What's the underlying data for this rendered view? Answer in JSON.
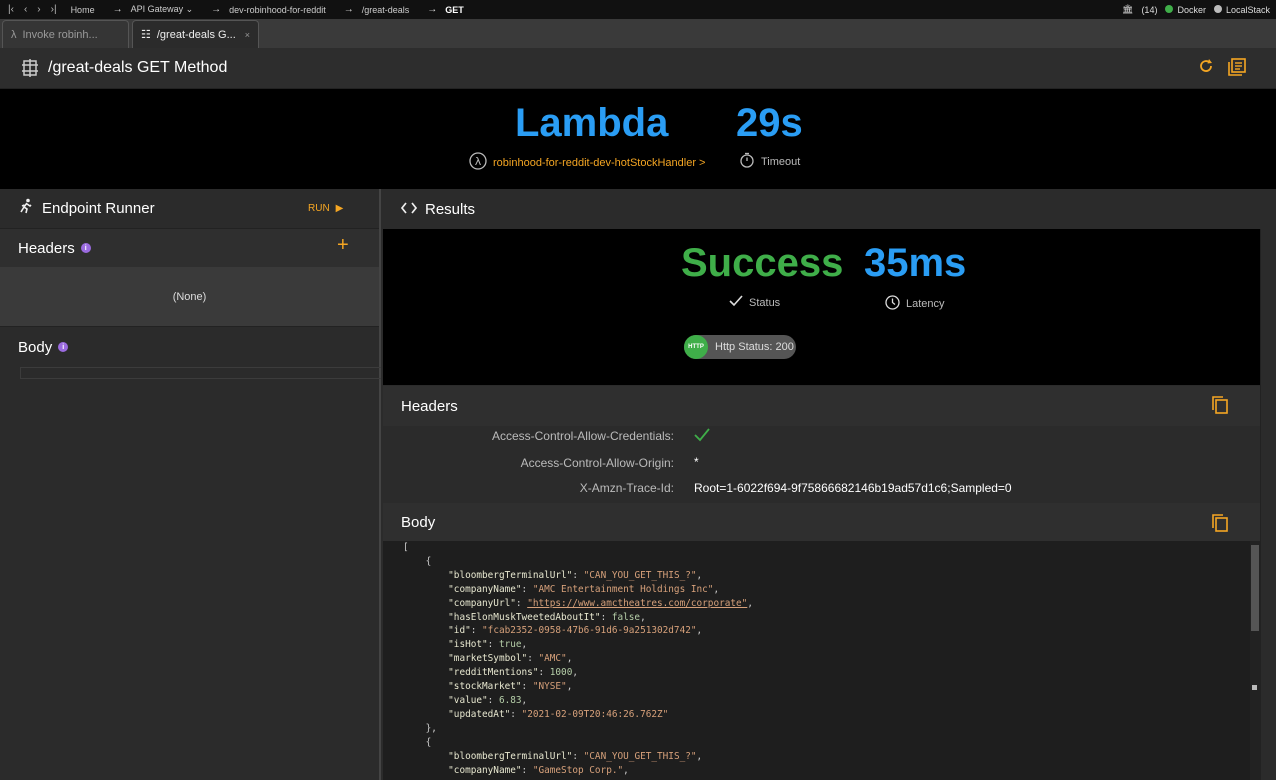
{
  "topbar": {
    "breadcrumb": [
      "Home",
      "API Gateway",
      "dev-robinhood-for-reddit",
      "/great-deals",
      "GET"
    ],
    "count": "(14)",
    "docker": "Docker",
    "localstack": "LocalStack",
    "colors": {
      "docker": "#3fae49",
      "localstack": "#bbbbbb"
    }
  },
  "tabs": [
    {
      "label": "Invoke robinh...",
      "icon": "lambda-icon"
    },
    {
      "label": "/great-deals G...",
      "icon": "api-gateway-icon",
      "close": "×"
    }
  ],
  "header": {
    "title": "/great-deals GET Method"
  },
  "hero": {
    "lambda_label": "Lambda",
    "timeout_value": "29s",
    "function_link": "robinhood-for-reddit-dev-hotStockHandler >",
    "timeout_label": "Timeout"
  },
  "runner": {
    "title": "Endpoint Runner",
    "run_label": "RUN",
    "headers_title": "Headers",
    "headers_empty": "(None)",
    "body_title": "Body"
  },
  "results": {
    "title": "Results",
    "status_value": "Success",
    "status_label": "Status",
    "latency_value": "35ms",
    "latency_label": "Latency",
    "http_badge": "HTTP",
    "http_status": "Http Status: 200",
    "headers_title": "Headers",
    "headers": [
      {
        "key": "Access-Control-Allow-Credentials:",
        "value": "",
        "check": true
      },
      {
        "key": "Access-Control-Allow-Origin:",
        "value": "*"
      },
      {
        "key": "X-Amzn-Trace-Id:",
        "value": "Root=1-6022f694-9f75866682146b19ad57d1c6;Sampled=0"
      }
    ],
    "body_title": "Body",
    "body_lines": [
      {
        "t": "p",
        "text": "["
      },
      {
        "t": "p",
        "text": "    {"
      },
      {
        "t": "kv",
        "key": "\"bloombergTerminalUrl\"",
        "val": "\"CAN_YOU_GET_THIS_?\"",
        "vt": "s"
      },
      {
        "t": "kv",
        "key": "\"companyName\"",
        "val": "\"AMC Entertainment Holdings Inc\"",
        "vt": "s"
      },
      {
        "t": "kv",
        "key": "\"companyUrl\"",
        "val": "\"https://www.amctheatres.com/corporate\"",
        "vt": "u"
      },
      {
        "t": "kv",
        "key": "\"hasElonMuskTweetedAboutIt\"",
        "val": "false",
        "vt": "n"
      },
      {
        "t": "kv",
        "key": "\"id\"",
        "val": "\"fcab2352-0958-47b6-91d6-9a251302d742\"",
        "vt": "s"
      },
      {
        "t": "kv",
        "key": "\"isHot\"",
        "val": "true",
        "vt": "n"
      },
      {
        "t": "kv",
        "key": "\"marketSymbol\"",
        "val": "\"AMC\"",
        "vt": "s"
      },
      {
        "t": "kv",
        "key": "\"redditMentions\"",
        "val": "1000",
        "vt": "n"
      },
      {
        "t": "kv",
        "key": "\"stockMarket\"",
        "val": "\"NYSE\"",
        "vt": "s"
      },
      {
        "t": "kv",
        "key": "\"value\"",
        "val": "6.83",
        "vt": "n"
      },
      {
        "t": "kv",
        "key": "\"updatedAt\"",
        "val": "\"2021-02-09T20:46:26.762Z\"",
        "vt": "s",
        "last": true
      },
      {
        "t": "p",
        "text": "    },"
      },
      {
        "t": "p",
        "text": "    {"
      },
      {
        "t": "kv",
        "key": "\"bloombergTerminalUrl\"",
        "val": "\"CAN_YOU_GET_THIS_?\"",
        "vt": "s"
      },
      {
        "t": "kv",
        "key": "\"companyName\"",
        "val": "\"GameStop Corp.\"",
        "vt": "s"
      }
    ]
  }
}
